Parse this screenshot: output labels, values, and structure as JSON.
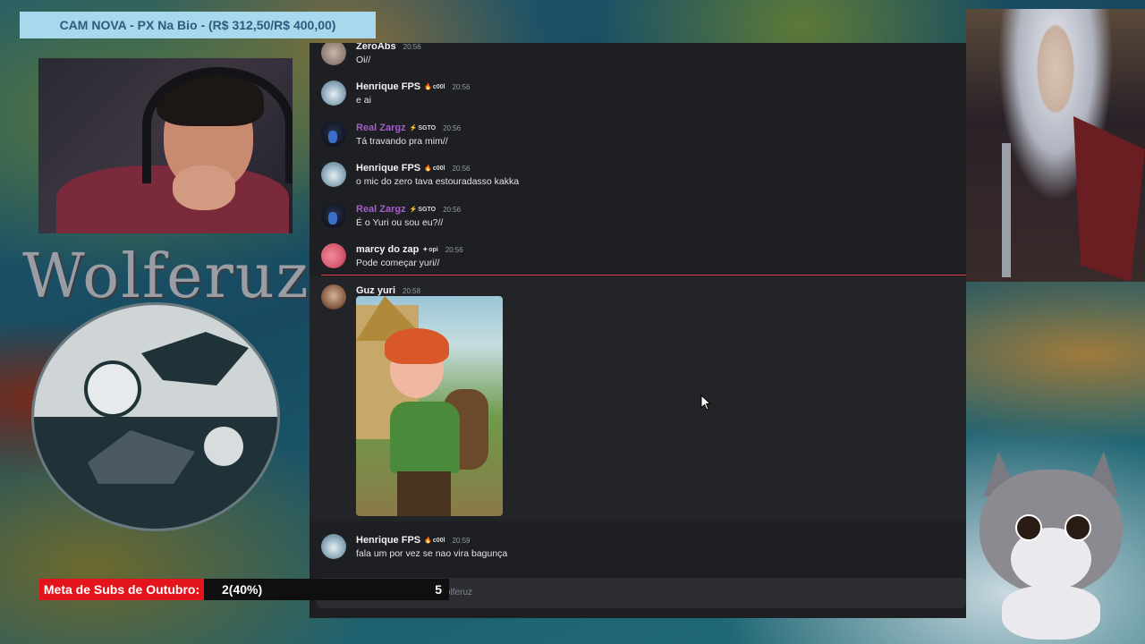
{
  "stream": {
    "banner": "CAM NOVA - PX Na Bio - (R$ 312,50/R$ 400,00)",
    "logo_text": "Wolferuz",
    "sub_goal": {
      "label": "Meta de Subs de Outubro:",
      "progress_text": "2(40%)",
      "target": "5",
      "progress_fraction": 0.4
    }
  },
  "chat": {
    "messages": [
      {
        "author": "ZeroAbs",
        "badge": "",
        "time": "20:56",
        "text": "Oi//",
        "avatar": "grey-avatar"
      },
      {
        "author": "Henrique FPS",
        "badge": "c00l",
        "time": "20:56",
        "text": "e ai",
        "avatar": "ice-avatar"
      },
      {
        "author": "Real Zargz",
        "badge": "SGTO",
        "time": "20:56",
        "text": "Tá travando pra mim//",
        "avatar": "dark-avatar"
      },
      {
        "author": "Henrique FPS",
        "badge": "c00l",
        "time": "20:56",
        "text": "o mic do zero tava estouradasso kakka",
        "avatar": "ice-avatar"
      },
      {
        "author": "Real Zargz",
        "badge": "SGTO",
        "time": "20:56",
        "text": "É o Yuri ou sou eu?//",
        "avatar": "dark-avatar"
      },
      {
        "author": "marcy do zap",
        "badge": "opi",
        "time": "20:56",
        "text": "Pode começar yuri//",
        "avatar": "pink-avatar"
      },
      {
        "author": "Guz yuri",
        "badge": "",
        "time": "20:58",
        "text": "",
        "avatar": "face-avatar"
      },
      {
        "author": "Henrique FPS",
        "badge": "c00l",
        "time": "20:59",
        "text": "fala um por vez se nao vira bagunça",
        "avatar": "ice-avatar"
      }
    ],
    "input_placeholder": "olferuz"
  }
}
